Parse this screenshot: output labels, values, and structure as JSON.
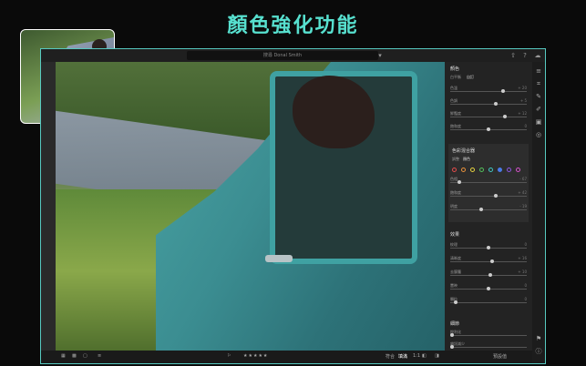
{
  "headline": "顏色強化功能",
  "search": {
    "placeholder": "搜尋 Donal Smith"
  },
  "panel": {
    "color_section": "顏色",
    "profile_label": "白平衡",
    "profile_value": "自訂",
    "rows_top": [
      {
        "label": "色溫",
        "value": "+ 20",
        "pos": 0.7
      },
      {
        "label": "色調",
        "value": "+ 5",
        "pos": 0.6
      },
      {
        "label": "鮮豔度",
        "value": "+ 12",
        "pos": 0.72
      },
      {
        "label": "飽和度",
        "value": "0",
        "pos": 0.5
      }
    ],
    "mixer_title": "色彩混合器",
    "mixer_adjust_label": "調整",
    "mixer_adjust_value": "顏色",
    "mixer_rows": [
      {
        "label": "色相",
        "value": "- 67",
        "pos": 0.1
      },
      {
        "label": "飽和度",
        "value": "+ 42",
        "pos": 0.6
      },
      {
        "label": "明度",
        "value": "- 19",
        "pos": 0.4
      }
    ],
    "effects_section": "效果",
    "effects_rows": [
      {
        "label": "紋理",
        "value": "0",
        "pos": 0.5
      },
      {
        "label": "清晰度",
        "value": "+ 16",
        "pos": 0.55
      },
      {
        "label": "去朦朧",
        "value": "+ 10",
        "pos": 0.53
      },
      {
        "label": "暈映",
        "value": "0",
        "pos": 0.5
      },
      {
        "label": "顆粒",
        "value": "0",
        "pos": 0.05
      }
    ],
    "detail_section": "細節",
    "detail_rows": [
      {
        "label": "銳利化",
        "value": "",
        "pos": 0.0
      },
      {
        "label": "雜訊減少",
        "value": "",
        "pos": 0.0
      }
    ],
    "mixer_colors": [
      "#e54b4b",
      "#e8913a",
      "#e6d33f",
      "#53c25b",
      "#3fc7c0",
      "#4a7be8",
      "#8a55e0",
      "#d452c9"
    ]
  },
  "bottom": {
    "fit_label": "符合",
    "fill_label": "填滿",
    "ratio_label": "1:1",
    "rating": "★★★★★",
    "reset_label": "預設值"
  },
  "colors": {
    "accent": "#57e0cf",
    "panel_bg": "#232323"
  }
}
